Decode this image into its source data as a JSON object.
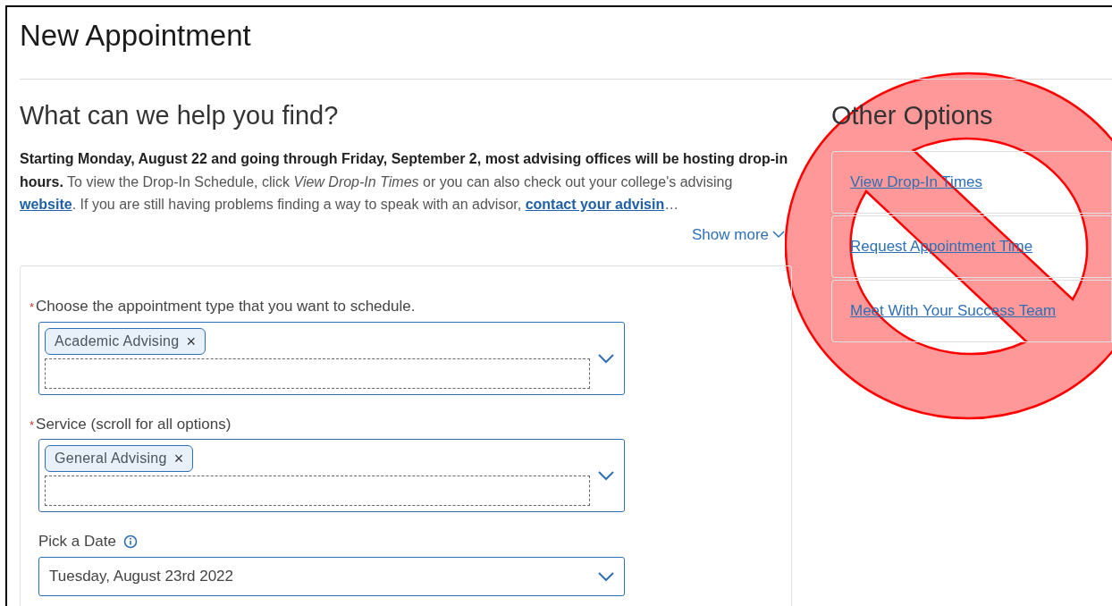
{
  "page": {
    "title": "New Appointment"
  },
  "main": {
    "heading": "What can we help you find?",
    "intro": [
      {
        "kind": "bold",
        "text": "Starting Monday, August 22 and going through Friday, September 2, most advising offices will be hosting drop-in hours."
      },
      {
        "kind": "text",
        "text": " To view the Drop-In Schedule, click "
      },
      {
        "kind": "italic",
        "text": "View Drop-In Times"
      },
      {
        "kind": "text",
        "text": " or you can also check out your college's advising "
      },
      {
        "kind": "link",
        "text": "website"
      },
      {
        "kind": "text",
        "text": ". If you are still having problems finding a way to speak with an advisor, "
      },
      {
        "kind": "link",
        "text": "contact your advisin"
      },
      {
        "kind": "text",
        "text": "…"
      }
    ],
    "show_more": "Show more",
    "fields": [
      {
        "kind": "multiselect",
        "required_mark": "*",
        "label": "Choose the appointment type that you want to schedule.",
        "chips": [
          {
            "label": "Academic Advising",
            "remove": "×"
          }
        ]
      },
      {
        "kind": "multiselect",
        "required_mark": "*",
        "label": "Service (scroll for all options)",
        "chips": [
          {
            "label": "General Advising",
            "remove": "×"
          }
        ]
      },
      {
        "kind": "select",
        "label": "Pick a Date",
        "info": true,
        "value": "Tuesday, August 23rd 2022"
      }
    ]
  },
  "sidebar": {
    "heading": "Other Options",
    "links": [
      "View Drop-In Times",
      "Request Appointment Time",
      "Meet With Your Success Team"
    ],
    "overlay": {
      "kind": "prohibition"
    }
  }
}
